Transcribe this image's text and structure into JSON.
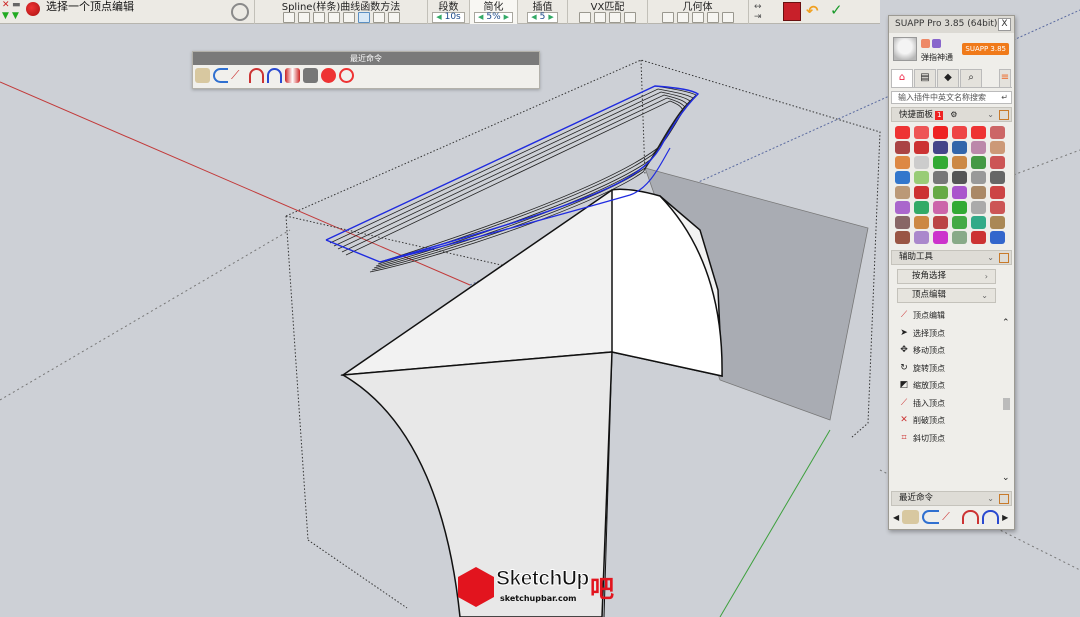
{
  "toolbar": {
    "vertex_edit_label": "选择一个顶点编辑",
    "spline_title": "Spline(样条)曲线函数方法",
    "segments_title": "段数",
    "segments_value": "10s",
    "simplify_title": "简化",
    "simplify_value": "5%",
    "interp_title": "插值",
    "interp_value": "5",
    "vx_title": "VX匹配",
    "geom_title": "几何体"
  },
  "recent_float": {
    "title": "最近命令"
  },
  "suapp": {
    "title": "SUAPP Pro 3.85 (64bit)",
    "close": "X",
    "user_name": "弹指神通",
    "version_badge": "SUAPP 3.85",
    "search_placeholder": "输入插件中英文名称搜索",
    "quick_panel_label": "快捷面板",
    "quick_panel_num": "1",
    "aux_tools_label": "辅助工具",
    "select_by_angle": "按角选择",
    "vertex_edit_sub": "顶点编辑",
    "vertex_items": [
      "顶点编辑",
      "选择顶点",
      "移动顶点",
      "旋转顶点",
      "缩放顶点",
      "插入顶点",
      "削破顶点",
      "斜切顶点"
    ],
    "recent_label": "最近命令"
  },
  "watermark": {
    "brand": "SketchUp",
    "brand_suffix": "吧",
    "url": "sketchupbar.com"
  }
}
